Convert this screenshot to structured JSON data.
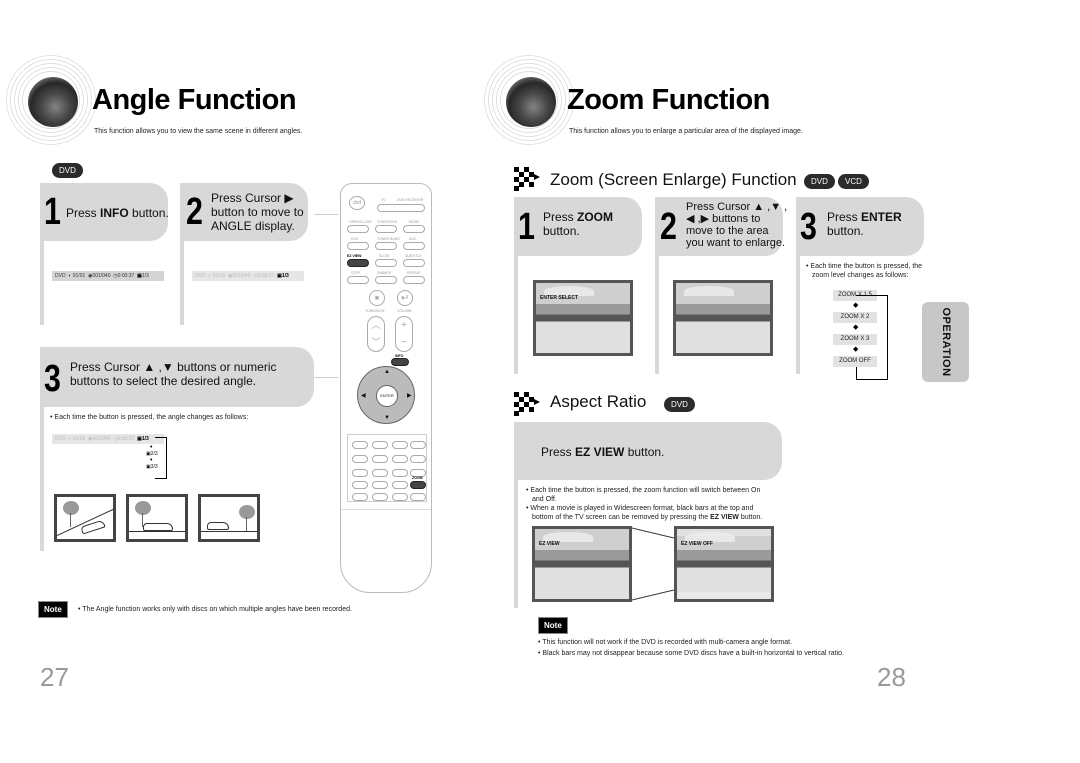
{
  "left_page": {
    "title": "Angle Function",
    "subtitle": "This function allows you to view the same scene in different angles.",
    "disc_badge": "DVD",
    "steps": [
      {
        "number": "1",
        "text_pre": "Press ",
        "text_bold": "INFO",
        "text_post": " button."
      },
      {
        "number": "2",
        "text_line1": "Press Cursor ▶",
        "text_line2": "button to move to",
        "text_line3": "ANGLE display."
      },
      {
        "number": "3",
        "text_line1": "Press Cursor ▲ ,▼  buttons or numeric",
        "text_line2": "buttons to select the desired angle."
      }
    ],
    "info_bar_1": {
      "disc": "DVD",
      "title": "01/01",
      "chapter": "001/040",
      "time": "0:00:37",
      "angle": "1/3"
    },
    "info_bar_2": {
      "disc": "DVD",
      "title": "01/01",
      "chapter": "001/040",
      "time": "0:00:37",
      "angle": "1/3"
    },
    "bullet": "• Each time the button is pressed, the angle changes as follows:",
    "angle_sequence": [
      "1/3",
      "2/3",
      "3/3"
    ],
    "note_label": "Note",
    "note_text": "• The Angle function works only with discs on which multiple angles have been recorded.",
    "page_number": "27"
  },
  "remote": {
    "labels": [
      "DVD",
      "TV",
      "DVD RECEIVER",
      "OPEN/CLOSE",
      "TUNER/DVD",
      "MODE",
      "DVD",
      "TUNER BAND",
      "AUX",
      "EZ VIEW",
      "SLOW",
      "SUBTITLE",
      "STEP",
      "DIMMER",
      "REPEAT",
      "TUNING/CH",
      "VOLUME",
      "ENTER",
      "INFO",
      "ZOOM"
    ],
    "highlighted": [
      "EZ VIEW",
      "INFO",
      "ZOOM"
    ]
  },
  "right_page": {
    "title": "Zoom Function",
    "subtitle": "This function allows you to enlarge a particular area of the displayed image.",
    "zoom_section": {
      "heading": "Zoom (Screen Enlarge) Function",
      "badges": [
        "DVD",
        "VCD"
      ],
      "steps": [
        {
          "number": "1",
          "text_pre": "Press ",
          "text_bold": "ZOOM",
          "text_post": "button."
        },
        {
          "number": "2",
          "text_line1": "Press Cursor ▲ ,▼ ,",
          "text_line2": "◀ ,▶ buttons to",
          "text_line3": "move to the area",
          "text_line4": "you want to enlarge."
        },
        {
          "number": "3",
          "text_pre": "Press ",
          "text_bold": "ENTER",
          "text_post": "button."
        }
      ],
      "photo_label": "ENTER SELECT",
      "bullet_line1": "• Each time the button is pressed, the",
      "bullet_line2": "zoom level changes as follows:",
      "zoom_levels": [
        "ZOOM X 1.5",
        "ZOOM X 2",
        "ZOOM X 3",
        "ZOOM  OFF"
      ]
    },
    "aspect_section": {
      "heading": "Aspect Ratio",
      "badge": "DVD",
      "step_pre": "Press ",
      "step_bold": "EZ VIEW",
      "step_post": " button.",
      "bullet1_line1": "• Each time the button is pressed, the zoom function will switch between On",
      "bullet1_line2": "and Off.",
      "bullet2_line1": "• When a movie is played in Widescreen format, black bars at the top and",
      "bullet2_line2_pre": "bottom of the TV screen can be removed by pressing the ",
      "bullet2_line2_bold": "EZ VIEW",
      "bullet2_line2_post": " button.",
      "photo_on_label": "EZ VIEW",
      "photo_off_label": "EZ VIEW OFF"
    },
    "note_label": "Note",
    "notes": [
      "• This function will not work if the DVD is recorded with multi-camera angle format.",
      "• Black bars may not disappear because some DVD discs have a built-in horizontal to vertical ratio."
    ],
    "side_tab": "OPERATION",
    "page_number": "28"
  }
}
